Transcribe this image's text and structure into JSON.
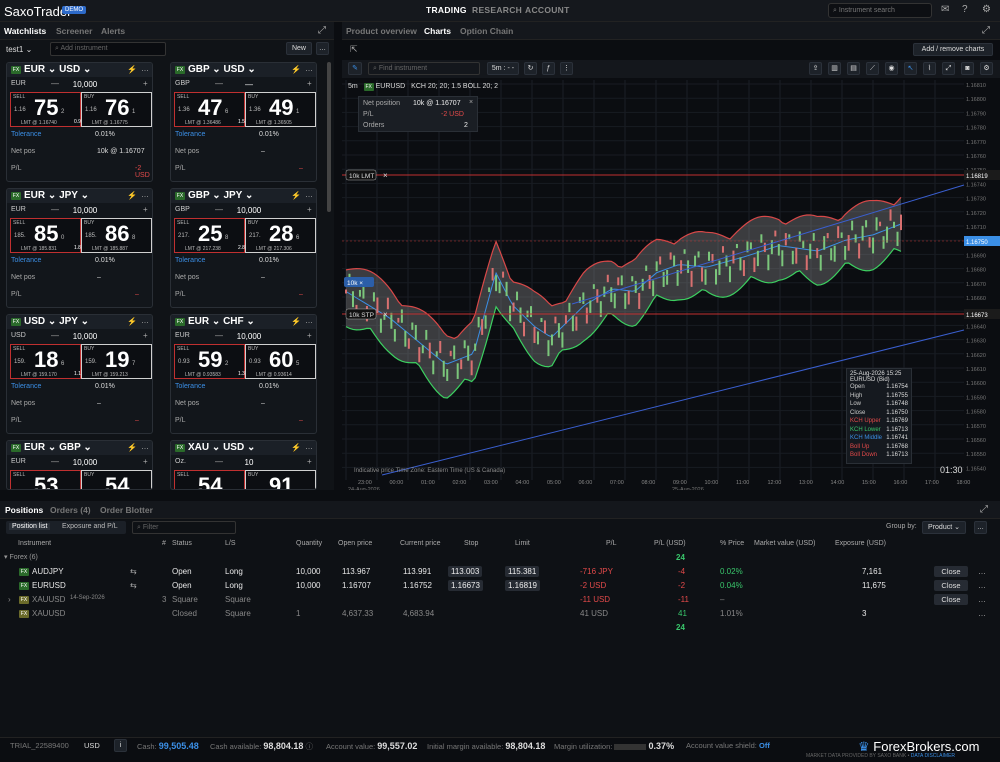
{
  "app": {
    "logo": "SaxoTrader",
    "badge": "DEMO",
    "nav": [
      "TRADING",
      "RESEARCH",
      "ACCOUNT"
    ],
    "search_placeholder": "Instrument search"
  },
  "left_tabs": [
    "Watchlists",
    "Screener",
    "Alerts"
  ],
  "watchlist": {
    "name": "test1",
    "add_placeholder": "Add instrument",
    "new_label": "New"
  },
  "cards": [
    {
      "pair": [
        "EUR",
        "USD"
      ],
      "ccy": "EUR",
      "amount": "10,000",
      "sell_pre": "1.16",
      "sell_big": "75",
      "sell_sub": "2",
      "buy_pre": "1.16",
      "buy_big": "76",
      "buy_sub": "1",
      "sell_lmt": "LMT @ 1.16740",
      "buy_lmt": "LMT @ 1.16775",
      "spread": "0.9",
      "tol": "Tolerance",
      "tolv": "0.01%",
      "np": "Net pos",
      "npv": "10k @ 1.16707",
      "pl": "P/L",
      "plv": "-2 USD"
    },
    {
      "pair": [
        "GBP",
        "USD"
      ],
      "ccy": "GBP",
      "amount": "—",
      "sell_pre": "1.36",
      "sell_big": "47",
      "sell_sub": "6",
      "buy_pre": "1.36",
      "buy_big": "49",
      "buy_sub": "1",
      "sell_lmt": "LMT @ 1.36486",
      "buy_lmt": "LMT @ 1.36505",
      "spread": "1.5",
      "tol": "Tolerance",
      "tolv": "0.01%",
      "np": "Net pos",
      "npv": "–",
      "pl": "P/L",
      "plv": "–"
    },
    {
      "pair": [
        "EUR",
        "JPY"
      ],
      "ccy": "EUR",
      "amount": "10,000",
      "sell_pre": "185.",
      "sell_big": "85",
      "sell_sub": "0",
      "buy_pre": "185.",
      "buy_big": "86",
      "buy_sub": "8",
      "sell_lmt": "LMT @ 185.831",
      "buy_lmt": "LMT @ 185.887",
      "spread": "1.8",
      "tol": "Tolerance",
      "tolv": "0.01%",
      "np": "Net pos",
      "npv": "–",
      "pl": "P/L",
      "plv": "–"
    },
    {
      "pair": [
        "GBP",
        "JPY"
      ],
      "ccy": "GBP",
      "amount": "10,000",
      "sell_pre": "217.",
      "sell_big": "25",
      "sell_sub": "8",
      "buy_pre": "217.",
      "buy_big": "28",
      "buy_sub": "6",
      "sell_lmt": "LMT @ 217.238",
      "buy_lmt": "LMT @ 217.306",
      "spread": "2.8",
      "tol": "Tolerance",
      "tolv": "0.01%",
      "np": "Net pos",
      "npv": "–",
      "pl": "P/L",
      "plv": "–"
    },
    {
      "pair": [
        "USD",
        "JPY"
      ],
      "ccy": "USD",
      "amount": "10,000",
      "sell_pre": "159.",
      "sell_big": "18",
      "sell_sub": "6",
      "buy_pre": "159.",
      "buy_big": "19",
      "buy_sub": "7",
      "sell_lmt": "LMT @ 159.170",
      "buy_lmt": "LMT @ 159.213",
      "spread": "1.1",
      "tol": "Tolerance",
      "tolv": "0.01%",
      "np": "Net pos",
      "npv": "–",
      "pl": "P/L",
      "plv": "–"
    },
    {
      "pair": [
        "EUR",
        "CHF"
      ],
      "ccy": "EUR",
      "amount": "10,000",
      "sell_pre": "0.93",
      "sell_big": "59",
      "sell_sub": "2",
      "buy_pre": "0.93",
      "buy_big": "60",
      "buy_sub": "5",
      "sell_lmt": "LMT @ 0.93583",
      "buy_lmt": "LMT @ 0.93614",
      "spread": "1.3",
      "tol": "Tolerance",
      "tolv": "0.01%",
      "np": "Net pos",
      "npv": "–",
      "pl": "P/L",
      "plv": "–"
    },
    {
      "pair": [
        "EUR",
        "GBP"
      ],
      "ccy": "EUR",
      "amount": "10,000",
      "sell_pre": "",
      "sell_big": "53",
      "sell_sub": "",
      "buy_pre": "",
      "buy_big": "54",
      "buy_sub": "",
      "sell_lmt": "",
      "buy_lmt": "",
      "spread": "",
      "tol": "",
      "tolv": "",
      "np": "",
      "npv": "",
      "pl": "",
      "plv": ""
    },
    {
      "pair": [
        "XAU",
        "USD"
      ],
      "ccy": "Oz.",
      "amount": "10",
      "sell_pre": "",
      "sell_big": "54",
      "sell_sub": "",
      "buy_pre": "",
      "buy_big": "91",
      "buy_sub": "",
      "sell_lmt": "",
      "buy_lmt": "",
      "spread": "",
      "tol": "",
      "tolv": "",
      "np": "",
      "npv": "",
      "pl": "",
      "plv": ""
    }
  ],
  "chart_tabs": [
    "Product overview",
    "Charts",
    "Option Chain"
  ],
  "chart": {
    "add_remove": "Add / remove charts",
    "find_placeholder": "Find instrument",
    "interval": "5m : - -",
    "legend": "KCH 20; 20; 1.5   BOLL 20; 2",
    "symbol": "EURUSD",
    "tf": "5m",
    "netpos": {
      "l1": "Net position",
      "v1": "10k @ 1.16707",
      "l2": "P/L",
      "v2": "-2 USD",
      "l3": "Orders",
      "v3": "2"
    },
    "lmt": "10k LMT",
    "stp": "10k STP",
    "pos": "10k",
    "ylabels": [
      "1.16810",
      "1.16800",
      "1.16790",
      "1.16780",
      "1.16770",
      "1.16760",
      "1.16750",
      "1.16740",
      "1.16730",
      "1.16720",
      "1.16710",
      "1.16700",
      "1.16690",
      "1.16680",
      "1.16670",
      "1.16660",
      "1.16650",
      "1.16640",
      "1.16630",
      "1.16620",
      "1.16610",
      "1.16600",
      "1.16590",
      "1.16580",
      "1.16570",
      "1.16560",
      "1.16550",
      "1.16540"
    ],
    "lmt_price": "1.16819",
    "curr_price": "1.16750",
    "stp_price": "1.16673",
    "xlabels": [
      "23:00",
      "00:00",
      "01:00",
      "02:00",
      "03:00",
      "04:00",
      "05:00",
      "06:00",
      "07:00",
      "08:00",
      "09:00",
      "10:00",
      "11:00",
      "12:00",
      "13:00",
      "14:00",
      "15:00",
      "16:00",
      "17:00",
      "18:00"
    ],
    "date1": "24-Aug-2026",
    "date2": "25-Aug-2026",
    "footer_left": "Indicative price   Time Zone: Eastern Time (US & Canada)",
    "clock": "01:30",
    "tooltip": {
      "title": "25-Aug-2026 15:25",
      "sub": "EURUSD (Bid)",
      "rows": [
        [
          "Open",
          "1.16754"
        ],
        [
          "High",
          "1.16755"
        ],
        [
          "Low",
          "1.16748"
        ],
        [
          "Close",
          "1.16750"
        ],
        [
          "KCH Upper",
          "1.16769"
        ],
        [
          "KCH Lower",
          "1.16713"
        ],
        [
          "KCH Middle",
          "1.16741"
        ],
        [
          "Boll Up",
          "1.16768"
        ],
        [
          "Boll Down",
          "1.16713"
        ]
      ]
    }
  },
  "positions": {
    "tabs": [
      "Positions",
      "Orders (4)",
      "Order Blotter"
    ],
    "subtabs": [
      "Position list",
      "Exposure and P/L"
    ],
    "filter": "Filter",
    "groupby": "Group by:",
    "groupval": "Product",
    "cols": [
      "Instrument",
      "#",
      "Status",
      "L/S",
      "Quantity",
      "Open price",
      "Current price",
      "Stop",
      "Limit",
      "P/L",
      "P/L (USD)",
      "% Price",
      "Market value (USD)",
      "Exposure (USD)"
    ],
    "group": "Forex (6)",
    "total1": "24",
    "total2": "24",
    "rows": [
      {
        "inst": "AUDJPY",
        "status": "Open",
        "ls": "Long",
        "qty": "10,000",
        "open": "113.967",
        "cur": "113.991",
        "stop": "113.003",
        "limit": "115.381",
        "pl": "-716 JPY",
        "plusd": "-4",
        "pct": "0.02%",
        "mv": "",
        "exp": "7,161",
        "btn": "Close"
      },
      {
        "inst": "EURUSD",
        "status": "Open",
        "ls": "Long",
        "qty": "10,000",
        "open": "1.16707",
        "cur": "1.16752",
        "stop": "1.16673",
        "limit": "1.16819",
        "pl": "-2 USD",
        "plusd": "-2",
        "pct": "0.04%",
        "mv": "",
        "exp": "11,675",
        "btn": "Close"
      },
      {
        "inst": "XAUUSD",
        "date": "14-Sep-2026",
        "num": "3",
        "status": "Square",
        "ls": "Square",
        "qty": "",
        "open": "",
        "cur": "",
        "stop": "",
        "limit": "",
        "pl": "-11 USD",
        "plusd": "-11",
        "pct": "–",
        "mv": "",
        "exp": "",
        "btn": "Close"
      },
      {
        "inst": "XAUUSD",
        "num": "",
        "status": "Closed",
        "ls": "Square",
        "qty": "1",
        "open": "4,637.33",
        "cur": "4,683.94",
        "stop": "",
        "limit": "",
        "pl": "41 USD",
        "plusd": "41",
        "pct": "1.01%",
        "mv": "",
        "exp": "3",
        "btn": ""
      }
    ]
  },
  "footer": {
    "account": "TRIAL_22589400",
    "ccy": "USD",
    "cash_l": "Cash:",
    "cash": "99,505.48",
    "avail_l": "Cash available:",
    "avail": "98,804.18",
    "accv_l": "Account value:",
    "accv": "99,557.02",
    "im_l": "Initial margin available:",
    "im": "98,804.18",
    "mu_l": "Margin utilization:",
    "mu": "0.37%",
    "shield_l": "Account value shield:",
    "shield": "Off",
    "credit": "MARKET DATA PROVIDED BY SAXO BANK",
    "disc": "DATA DISCLAIMER",
    "fb": "ForexBrokers.com"
  }
}
